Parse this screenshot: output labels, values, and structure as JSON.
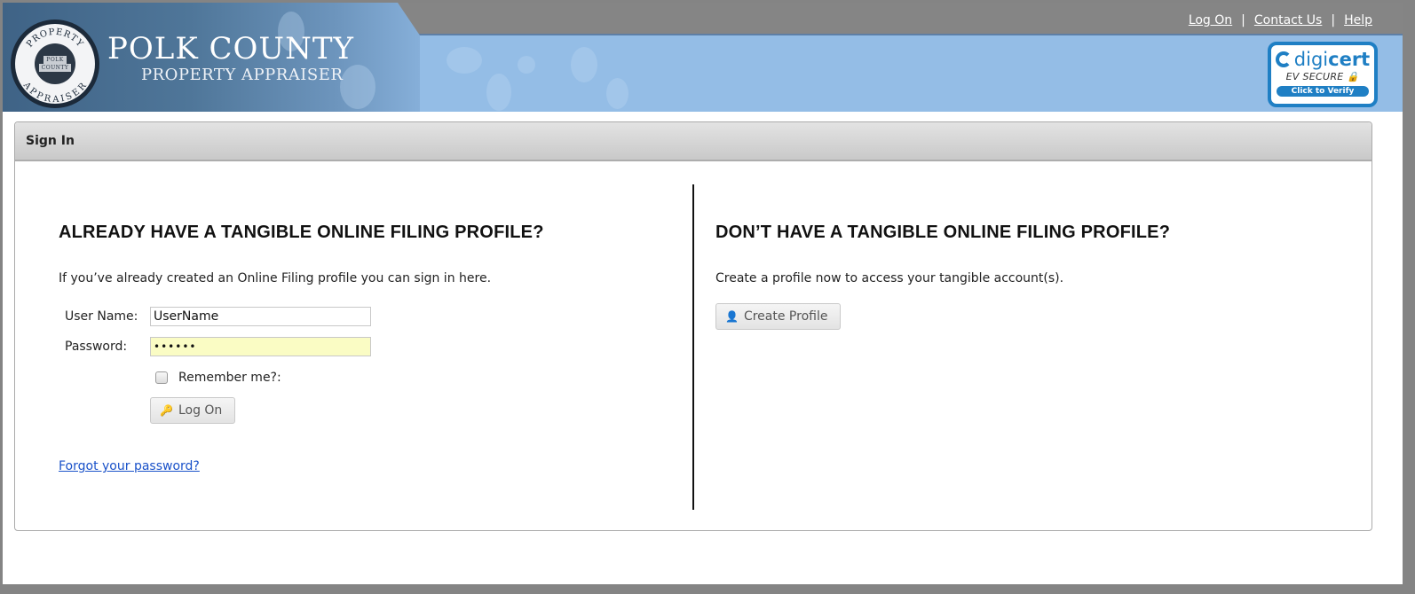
{
  "header": {
    "brand_title": "POLK COUNTY",
    "brand_subtitle": "PROPERTY APPRAISER",
    "seal": {
      "ring_top": "PROPERTY",
      "ring_bottom": "APPRAISER",
      "shield_line1": "POLK",
      "shield_line2": "COUNTY"
    },
    "links": [
      {
        "label": "Log On"
      },
      {
        "label": "Contact Us"
      },
      {
        "label": "Help"
      }
    ],
    "separator": "|",
    "digicert": {
      "brand_digi": "digi",
      "brand_cert": "cert",
      "ev_text": "EV SECURE",
      "verify_text": "Click to Verify"
    }
  },
  "panel": {
    "title": "Sign In",
    "left": {
      "heading": "ALREADY HAVE A TANGIBLE ONLINE FILING PROFILE?",
      "intro": "If you’ve already created an Online Filing profile you can sign in here.",
      "username_label": "User Name:",
      "username_value": "UserName",
      "password_label": "Password:",
      "password_value": "••••••",
      "remember_label": "Remember me?:",
      "remember_checked": false,
      "logon_label": "Log On",
      "forgot_label": "Forgot your password?"
    },
    "right": {
      "heading": "DON’T HAVE A TANGIBLE ONLINE FILING PROFILE?",
      "intro": "Create a profile now to access your tangible account(s).",
      "create_label": "Create Profile"
    }
  },
  "colors": {
    "frame": "#848484",
    "header_bg": "#94bde6",
    "link": "#1a52c9",
    "password_fill": "#fafcc4",
    "digicert_blue": "#1f7fc4"
  }
}
